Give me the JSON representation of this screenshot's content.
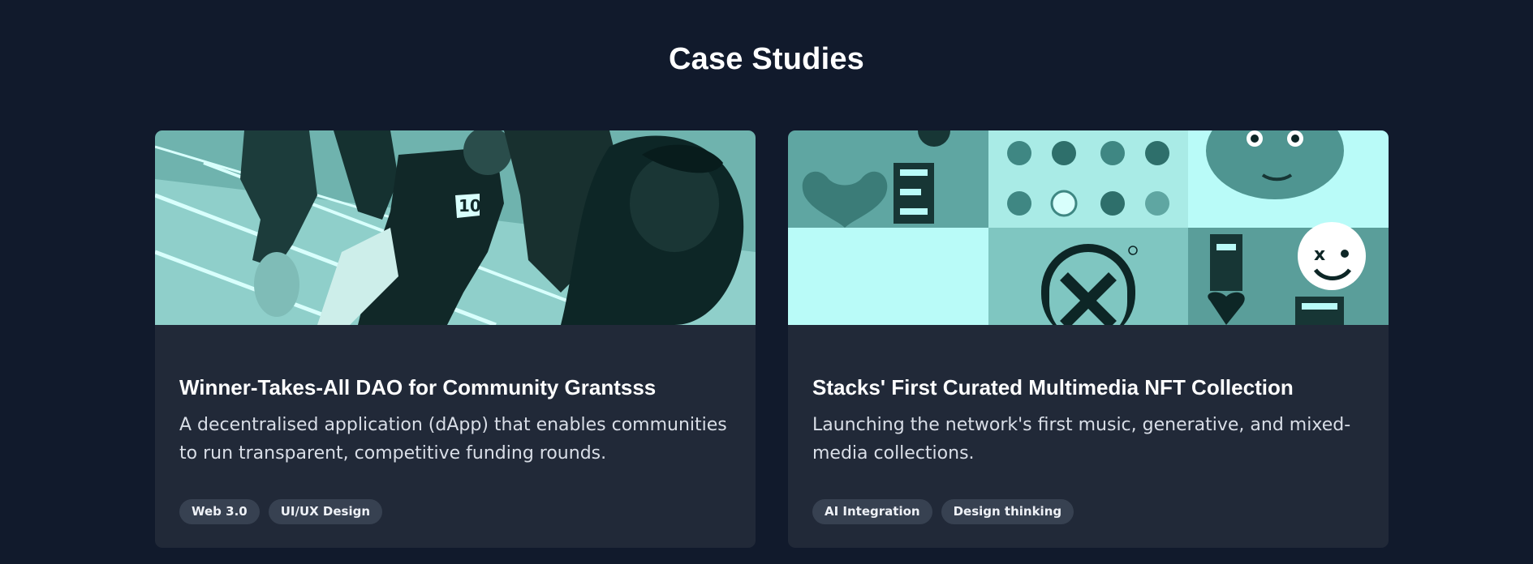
{
  "section": {
    "title": "Case Studies"
  },
  "cards": [
    {
      "title": "Winner-Takes-All DAO for Community Grantsss",
      "description": "A decentralised application (dApp) that enables communities to run transparent, competitive funding rounds.",
      "image_alt": "Runners racing on a track, teal duotone photo",
      "tags": [
        "Web 3.0",
        "UI/UX Design"
      ]
    },
    {
      "title": "Stacks' First Curated Multimedia NFT Collection",
      "description": "Launching the network's first music, generative, and mixed-media collections.",
      "image_alt": "Collage of NFT artwork tiles, teal duotone",
      "tags": [
        "AI Integration",
        "Design thinking"
      ]
    }
  ],
  "colors": {
    "background": "#111a2c",
    "card": "#212938",
    "tag": "#374151",
    "duotone_dark": "#0d2626",
    "duotone_mid": "#5fa6a2",
    "duotone_light": "#b9fbf8"
  }
}
